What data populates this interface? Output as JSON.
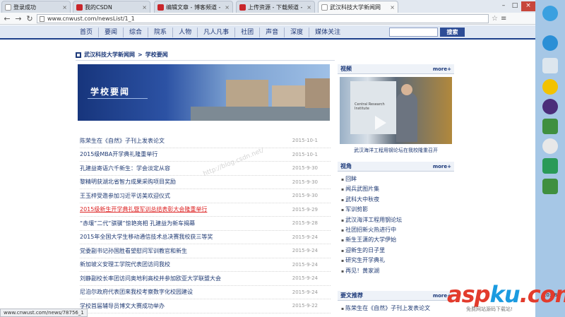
{
  "browser": {
    "tabs": [
      {
        "label": "登录成功",
        "icon": "page-icon"
      },
      {
        "label": "我的CSDN",
        "icon": "csdn-icon"
      },
      {
        "label": "编辑文章 - 博客频道 - CSI",
        "icon": "csdn-icon"
      },
      {
        "label": "上传资源 - 下载频道 - CSI",
        "icon": "csdn-icon"
      },
      {
        "label": "武汉科技大学新闻网",
        "icon": "page-icon"
      }
    ],
    "url": "www.cnwust.com/newsList/1_1",
    "status_url": "www.cnwust.com/news/78756_1"
  },
  "site_nav": {
    "items": [
      "首页",
      "要闻",
      "综合",
      "院系",
      "人物",
      "凡人凡事",
      "社团",
      "声音",
      "深度",
      "媒体关注"
    ],
    "search_placeholder": "",
    "search_button": "搜索"
  },
  "breadcrumb": {
    "site": "武汉科技大学新闻网",
    "separator": ">",
    "section": "学校要闻"
  },
  "banner": {
    "title": "学校要闻"
  },
  "news": [
    {
      "title": "陈荣生在《自然》子刊上发表论文",
      "date": "2015-10-1"
    },
    {
      "title": "2015级MBA开学典礼隆重举行",
      "date": "2015-10-1"
    },
    {
      "title": "孔建益寄语六千新生：学会淡定从容",
      "date": "2015-9-30"
    },
    {
      "title": "黎精明获湖北省智力成果采购项目奖励",
      "date": "2015-9-30"
    },
    {
      "title": "王玉梓受邀参加习近平访美欢迎仪式",
      "date": "2015-9-30"
    },
    {
      "title": "2015级新生开学典礼暨军训总结表彰大会隆重举行",
      "date": "2015-9-29"
    },
    {
      "title": "“赤壤”二代“骐骥”惊艳亮相 孔建益为新车揭幕",
      "date": "2015-9-28"
    },
    {
      "title": "2015年全国大学生移动通信技术总决赛我校获三等奖",
      "date": "2015-9-24"
    },
    {
      "title": "党委副书记孙国胜看望慰问军训教官和新生",
      "date": "2015-9-24"
    },
    {
      "title": "新加坡义安理工学院代表团访问我校",
      "date": "2015-9-24"
    },
    {
      "title": "刘静副校长率团访问奥地利高校并参加欧亚大学联盟大会",
      "date": "2015-9-24"
    },
    {
      "title": "尼泊尔政府代表团来我校考察数字化校园建设",
      "date": "2015-9-24"
    },
    {
      "title": "学校首届辅导员博文大赛成功举办",
      "date": "2015-9-22"
    }
  ],
  "watermark": "http://blog.csdn.net/",
  "video": {
    "heading": "视频",
    "more": "more+",
    "screen_text": "Central Research Institute",
    "caption": "武汉海洋工程用钢论坛在我校隆重召开"
  },
  "perspective": {
    "heading": "视角",
    "more": "more+",
    "items": [
      "回眸",
      "闻兵武图片集",
      "武科大中秋夜",
      "军训剪影",
      "武汉海洋工程用钢论坛",
      "社团招新火热进行中",
      "新生王潇的大学伊始",
      "迎新生的日子里",
      "研究生开学典礼",
      "再见！黄家湖"
    ]
  },
  "recommend": {
    "heading": "要文推荐",
    "more": "more+",
    "items": [
      "陈荣生在《自然》子刊上发表论文"
    ]
  },
  "desktop": {
    "clock": "10:58"
  },
  "brand": {
    "part1": "asp",
    "part2": "ku",
    "part3": ".com",
    "sub": "免费网站源码下载站!"
  }
}
